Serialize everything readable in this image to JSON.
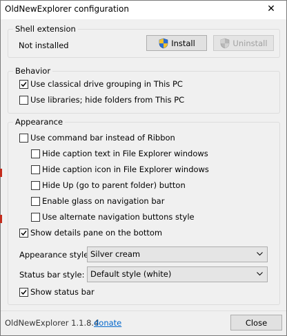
{
  "window": {
    "title": "OldNewExplorer configuration",
    "close_glyph": "✕"
  },
  "shell_extension": {
    "group_title": "Shell extension",
    "status": "Not installed",
    "install_label": "Install",
    "uninstall_label": "Uninstall"
  },
  "behavior": {
    "group_title": "Behavior",
    "options": [
      {
        "label": "Use classical drive grouping in This PC",
        "checked": true
      },
      {
        "label": "Use libraries; hide folders from This PC",
        "checked": false
      }
    ]
  },
  "appearance": {
    "group_title": "Appearance",
    "options": [
      {
        "label": "Use command bar instead of Ribbon",
        "checked": false
      },
      {
        "label": "Hide caption text in File Explorer windows",
        "checked": false
      },
      {
        "label": "Hide caption icon in File Explorer windows",
        "checked": false
      },
      {
        "label": "Hide Up (go to parent folder) button",
        "checked": false
      },
      {
        "label": "Enable glass on navigation bar",
        "checked": false
      },
      {
        "label": "Use alternate navigation buttons style",
        "checked": false
      },
      {
        "label": "Show details pane on the bottom",
        "checked": true
      }
    ],
    "appearance_style_label": "Appearance style:",
    "appearance_style_value": "Silver cream",
    "status_bar_style_label": "Status bar style:",
    "status_bar_style_value": "Default style (white)",
    "show_status_bar": {
      "label": "Show status bar",
      "checked": true
    }
  },
  "footer": {
    "version": "OldNewExplorer 1.1.8.4",
    "link": "donate",
    "close_label": "Close"
  },
  "colors": {
    "accent_link": "#0066cc",
    "shield_blue": "#2a6fd6",
    "shield_yellow": "#f2c12e",
    "side_strip": "#c42b1c"
  }
}
